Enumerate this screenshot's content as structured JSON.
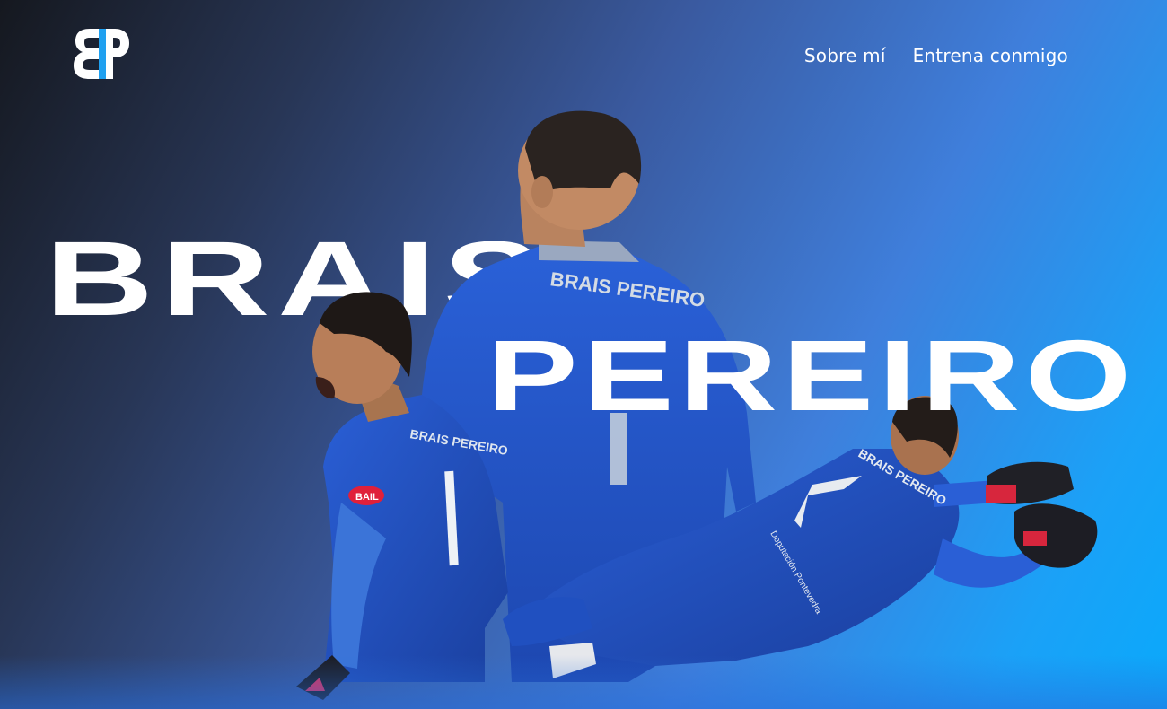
{
  "logo": {
    "alt_icon": "bp-monogram-icon",
    "accent": "#1fa0f0"
  },
  "nav": {
    "items": [
      {
        "label": "Sobre mí"
      },
      {
        "label": "Entrena conmigo"
      }
    ]
  },
  "hero": {
    "first_name": "BRAIS",
    "last_name": "PEREIRO",
    "background_colors": [
      "#15181f",
      "#3a5aa0",
      "#0aa9fb"
    ],
    "jersey_color": "#1f4fc4",
    "jersey_text": "BRAIS PEREIRO",
    "jersey_number": "1",
    "sponsor_text": "Deputación Pontevedra",
    "sleeve_badge": "BAIL"
  }
}
